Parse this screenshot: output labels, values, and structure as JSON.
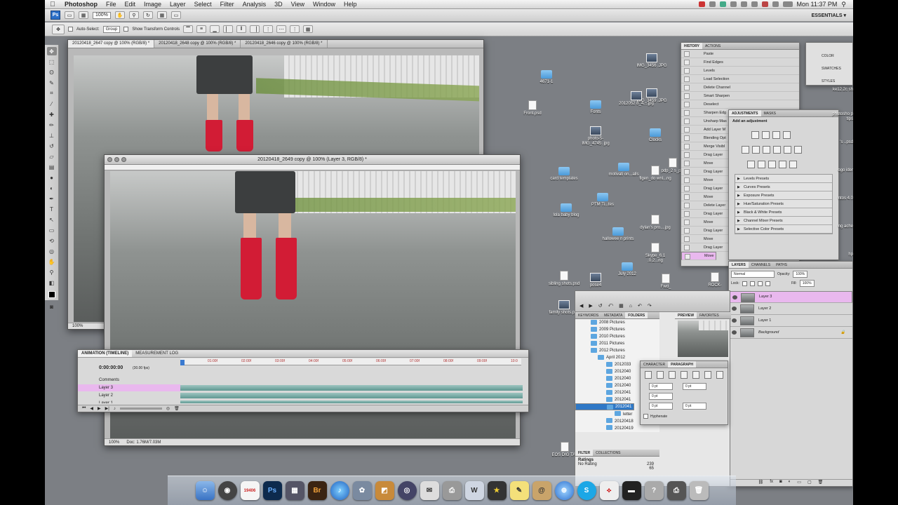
{
  "menubar": {
    "app": "Photoshop",
    "items": [
      "File",
      "Edit",
      "Image",
      "Layer",
      "Select",
      "Filter",
      "Analysis",
      "3D",
      "View",
      "Window",
      "Help"
    ],
    "clock": "Mon 11:37 PM"
  },
  "appbar": {
    "ps_label": "Ps",
    "zoom": "100%",
    "workspace": "ESSENTIALS ▾"
  },
  "options": {
    "auto_select_label": "Auto-Select:",
    "auto_select_value": "Group",
    "transform_label": "Show Transform Controls"
  },
  "documents": {
    "tabs": [
      "20120418_2647 copy @ 100% (RGB/8) *",
      "20120418_2648 copy @ 100% (RGB/8) *",
      "20120418_2646 copy @ 100% (RGB/8) *"
    ],
    "back_zoom": "100%",
    "front_title": "20120418_2649 copy @ 100% (Layer 3, RGB/8) *",
    "front_zoom": "100%",
    "front_doc_info": "Doc: 1.76M/7.03M"
  },
  "animation": {
    "tabs": [
      "ANIMATION (TIMELINE)",
      "MEASUREMENT LOG"
    ],
    "time": "0:00:00:00",
    "fps": "(30.00 fps)",
    "ticks": [
      "01:00f",
      "02:00f",
      "03:00f",
      "04:00f",
      "05:00f",
      "06:00f",
      "07:00f",
      "08:00f",
      "09:00f",
      "10:0"
    ],
    "rows": [
      "Comments",
      "Layer 3",
      "Layer 2",
      "Layer 1"
    ]
  },
  "desktop_icons": [
    {
      "label": "4671-1"
    },
    {
      "label": "Front.psd"
    },
    {
      "label": "Fonts"
    },
    {
      "label": "photo-5-IMG_4745 .jpg"
    },
    {
      "label": "Clocks"
    },
    {
      "label": "card templates"
    },
    {
      "label": "motivati on...alls"
    },
    {
      "label": "flgen_do wnl...ng"
    },
    {
      "label": "PTM Ti...tes"
    },
    {
      "label": "lola baby blog"
    },
    {
      "label": "dylan's pro....jpg"
    },
    {
      "label": "hallowee n prints"
    },
    {
      "label": "Skype_6.1 .0.2...ng"
    },
    {
      "label": "July 2012"
    },
    {
      "label": "sibling shots.psd"
    },
    {
      "label": "pose4"
    },
    {
      "label": "family shots.psd"
    },
    {
      "label": "IMG_3456 .JPG"
    },
    {
      "label": "IMG_3459 .JPG"
    },
    {
      "label": "2012052 8_4....jpg"
    },
    {
      "label": "pdp_2 s_p..."
    },
    {
      "label": "Fwd_"
    },
    {
      "label": "ROCK-"
    },
    {
      "label": "EOS DIG TAL"
    }
  ],
  "history": {
    "tabs": [
      "HISTORY",
      "ACTIONS"
    ],
    "items": [
      "Paste",
      "Find Edges",
      "Levels",
      "Load Selection",
      "Delete Channel",
      "Smart Sharpen",
      "Deselect",
      "Sharpen Edg",
      "Unsharp Mas",
      "Add Layer M",
      "Blending Opt",
      "Merge Visibl",
      "Drag Layer",
      "Move",
      "Drag Layer",
      "Move",
      "Drag Layer",
      "Move",
      "Delete Layer",
      "Drag Layer",
      "Move",
      "Drag Layer",
      "Move",
      "Drag Layer",
      "Move"
    ]
  },
  "color_panel": {
    "items": [
      "COLOR",
      "SWATCHES",
      "STYLES"
    ]
  },
  "adjustments": {
    "tabs": [
      "ADJUSTMENTS",
      "MASKS"
    ],
    "hint": "Add an adjustment",
    "presets": [
      "Levels Presets",
      "Curves Presets",
      "Exposure Presets",
      "Hue/Saturation Presets",
      "Black & White Presets",
      "Channel Mixer Presets",
      "Selective Color Presets"
    ]
  },
  "layers": {
    "tabs": [
      "LAYERS",
      "CHANNELS",
      "PATHS"
    ],
    "blend": "Normal",
    "opacity_label": "Opacity:",
    "opacity": "100%",
    "lock_label": "Lock:",
    "fill_label": "Fill:",
    "fill": "100%",
    "items": [
      "Layer 3",
      "Layer 2",
      "Layer 1",
      "Background"
    ]
  },
  "bridge": {
    "tabs": [
      "KEYWORDS",
      "METADATA",
      "FOLDERS"
    ],
    "preview_tabs": [
      "PREVIEW",
      "FAVORITES"
    ],
    "folders": [
      "2008 Pictures",
      "2009 Pictures",
      "2010 Pictures",
      "2011 Pictures",
      "2012 Pictures",
      "April 2012",
      "2012033",
      "2012040",
      "2012040",
      "2012040",
      "2012041",
      "2012041",
      "2012041",
      "letter",
      "20120418",
      "20120419"
    ],
    "filter_tabs": [
      "FILTER",
      "COLLECTIONS"
    ],
    "ratings_label": "Ratings",
    "no_rating": "No Rating",
    "no_rating_count": "239",
    "star_count": "65"
  },
  "character": {
    "tabs": [
      "CHARACTER",
      "PARAGRAPH"
    ],
    "pt": "0 pt",
    "hyphenate": "Hyphenate"
  },
  "right_edge_labels": [
    "ke12.2c sh",
    "photosho p tips",
    "'s ..psd",
    "ogo ider",
    "ntos 4.0",
    "ng ache",
    "hp"
  ],
  "dock": [
    "Finder",
    "Dashboard",
    "iCal",
    "Ps",
    "Mission",
    "Br",
    "iTunes",
    "iPhoto",
    "Preview",
    "Camera",
    "Mail",
    "Printer",
    "Word",
    "Stickies",
    "Notes",
    "Contacts",
    "Safari",
    "Skype",
    "Acrobat",
    "FCP",
    "Help",
    "Printer",
    "Trash"
  ],
  "colors": {
    "accent_select": "#e9b8ee",
    "folder_blue": "#2f78c6",
    "boots": "#d21c35"
  }
}
